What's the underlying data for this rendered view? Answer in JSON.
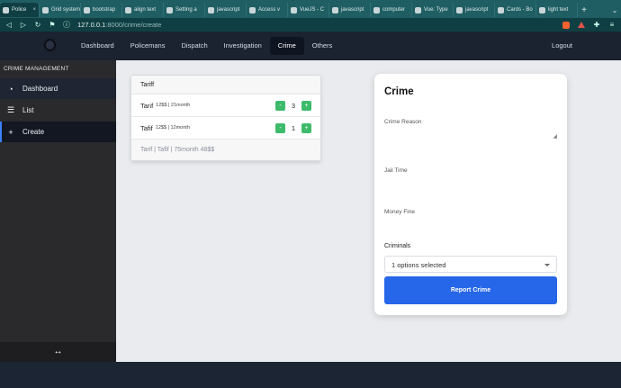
{
  "browser": {
    "tabs": [
      {
        "label": "Police",
        "active": true
      },
      {
        "label": "Grid system"
      },
      {
        "label": "bootstrap"
      },
      {
        "label": "align text"
      },
      {
        "label": "Setting a"
      },
      {
        "label": "javascript"
      },
      {
        "label": "Access v"
      },
      {
        "label": "VueJS - C"
      },
      {
        "label": "javascript"
      },
      {
        "label": "computer"
      },
      {
        "label": "Vue: Type"
      },
      {
        "label": "javascript"
      },
      {
        "label": "Cards - Bo"
      },
      {
        "label": "light text"
      }
    ],
    "url_host": "127.0.0.1",
    "url_path": ":8000/crime/create"
  },
  "nav": {
    "links": [
      "Dashboard",
      "Policemans",
      "Dispatch",
      "Investigation",
      "Crime",
      "Others"
    ],
    "active": "Crime",
    "logout": "Logout"
  },
  "sidebar": {
    "title": "CRIME MANAGEMENT",
    "items": [
      {
        "label": "Dashboard",
        "icon": "gauge-icon"
      },
      {
        "label": "List",
        "icon": "list-icon"
      },
      {
        "label": "Create",
        "icon": "plus-icon"
      }
    ],
    "footer_icon": "expand-arrows-icon"
  },
  "tariff": {
    "header": "Tariff",
    "rows": [
      {
        "name": "Tarif",
        "meta": "12$$ | 21month",
        "qty": "3"
      },
      {
        "name": "Tafif",
        "meta": "12$$ | 12month",
        "qty": "1"
      }
    ],
    "minus": "-",
    "plus": "+",
    "footer": "Tarif | Tafif | 75month 48$$"
  },
  "crime_form": {
    "title": "Crime",
    "reason_label": "Crime Reason",
    "jail_label": "Jail Time",
    "fine_label": "Money Fine",
    "criminals_label": "Criminals",
    "criminals_selected": "1 options selected",
    "submit": "Report Crime"
  }
}
